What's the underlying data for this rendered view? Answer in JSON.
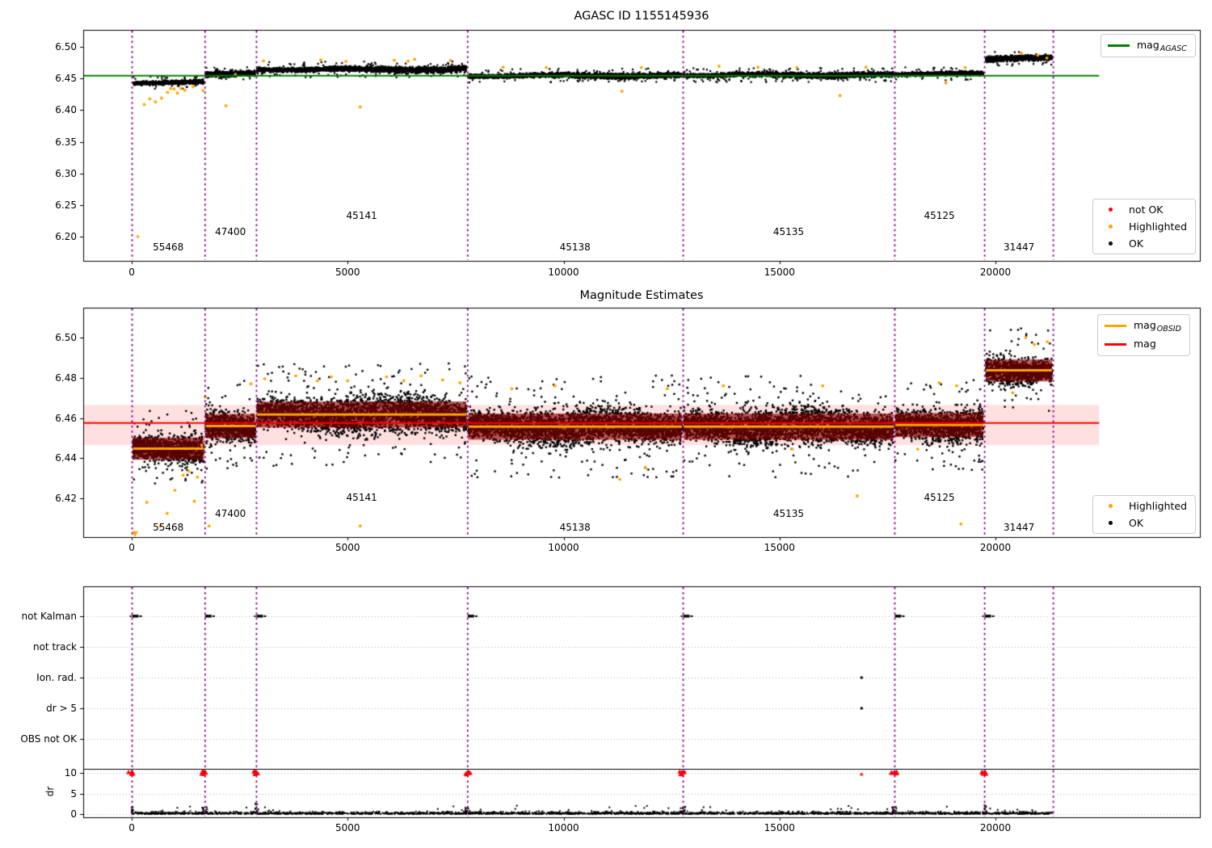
{
  "colors": {
    "mag_agasc_line": "#008000",
    "mag_line": "#ff0000",
    "mag_obsid_line": "#ffa500",
    "highlighted": "#ffa500",
    "not_ok": "#ff0000",
    "ok": "#000000",
    "obsid_boundary": "#8b008b",
    "mag_band_fill": "rgba(255,0,0,0.12)",
    "obsid_err_band_fill": "rgba(139,0,0,0.62)",
    "grid_line": "rgba(0,0,0,0.30)"
  },
  "shared": {
    "xticks": [
      0,
      5000,
      10000,
      15000,
      20000
    ],
    "xtick_labels": [
      "0",
      "5000",
      "10000",
      "15000",
      "20000"
    ],
    "xlim": [
      -1123,
      24733
    ],
    "obsid_boundaries": [
      0,
      1690,
      2880,
      7770,
      12760,
      17660,
      19740,
      21330
    ],
    "mag_line_x_end": 22400,
    "segments": [
      {
        "obsid": "55468",
        "x": [
          30,
          1670
        ],
        "label_x": 845,
        "tier": 0,
        "top": {
          "center": 6.4435,
          "half": 0.0055,
          "n": 900
        },
        "mid": {
          "center": 6.4447,
          "half": 0.01,
          "n": 1100,
          "band_half": 0.0055
        }
      },
      {
        "obsid": "47400",
        "x": [
          1710,
          2860
        ],
        "label_x": 2285,
        "tier": 1,
        "top": {
          "center": 6.458,
          "half": 0.0055,
          "n": 650
        },
        "mid": {
          "center": 6.456,
          "half": 0.012,
          "n": 800,
          "band_half": 0.006
        }
      },
      {
        "obsid": "45141",
        "x": [
          2900,
          7750
        ],
        "label_x": 5325,
        "tier": 2,
        "top": {
          "center": 6.4645,
          "half": 0.0068,
          "n": 2400
        },
        "mid": {
          "center": 6.4617,
          "half": 0.0135,
          "n": 3000,
          "band_half": 0.0065
        }
      },
      {
        "obsid": "45138",
        "x": [
          7790,
          12740
        ],
        "label_x": 10265,
        "tier": 0,
        "top": {
          "center": 6.4545,
          "half": 0.006,
          "n": 2400
        },
        "mid": {
          "center": 6.4557,
          "half": 0.0135,
          "n": 3000,
          "band_half": 0.0065
        }
      },
      {
        "obsid": "45135",
        "x": [
          12780,
          17640
        ],
        "label_x": 15210,
        "tier": 1,
        "top": {
          "center": 6.4555,
          "half": 0.006,
          "n": 2400
        },
        "mid": {
          "center": 6.4557,
          "half": 0.0135,
          "n": 3000,
          "band_half": 0.0065
        }
      },
      {
        "obsid": "45125",
        "x": [
          17680,
          19720
        ],
        "label_x": 18700,
        "tier": 2,
        "top": {
          "center": 6.4575,
          "half": 0.0055,
          "n": 1050
        },
        "mid": {
          "center": 6.4565,
          "half": 0.012,
          "n": 1300,
          "band_half": 0.006
        }
      },
      {
        "obsid": "31447",
        "x": [
          19780,
          21310
        ],
        "label_x": 20545,
        "tier": 0,
        "top": {
          "center": 6.4815,
          "half": 0.006,
          "n": 800
        },
        "mid": {
          "center": 6.4837,
          "half": 0.011,
          "n": 1000,
          "band_half": 0.0055
        }
      }
    ]
  },
  "chart_data": [
    {
      "id": "mag-vs-agasc",
      "type": "scatter",
      "title": "AGASC ID 1155145936",
      "ylim": [
        6.1615,
        6.527
      ],
      "yticks": [
        6.2,
        6.25,
        6.3,
        6.35,
        6.4,
        6.45,
        6.5
      ],
      "ytick_labels": [
        "6.20",
        "6.25",
        "6.30",
        "6.35",
        "6.40",
        "6.45",
        "6.50"
      ],
      "mag_agasc": 6.4545,
      "legend_line": {
        "base": "mag",
        "sub": "AGASC"
      },
      "legend_markers": [
        {
          "label": "not OK",
          "color": "not_ok"
        },
        {
          "label": "Highlighted",
          "color": "highlighted"
        },
        {
          "label": "OK",
          "color": "ok"
        }
      ],
      "label_tier_mags": [
        6.1835,
        6.2075,
        6.2325
      ],
      "highlighted_points": [
        [
          140,
          6.2
        ],
        [
          290,
          6.409
        ],
        [
          420,
          6.418
        ],
        [
          550,
          6.413
        ],
        [
          690,
          6.419
        ],
        [
          830,
          6.428
        ],
        [
          900,
          6.434
        ],
        [
          980,
          6.4335
        ],
        [
          1060,
          6.427
        ],
        [
          1140,
          6.4345
        ],
        [
          1230,
          6.4315
        ],
        [
          1420,
          6.437
        ],
        [
          1650,
          6.431
        ],
        [
          2180,
          6.407
        ],
        [
          2400,
          6.4565
        ],
        [
          3050,
          6.478
        ],
        [
          4380,
          6.4795
        ],
        [
          4960,
          6.477
        ],
        [
          5290,
          6.405
        ],
        [
          6080,
          6.479
        ],
        [
          6400,
          6.4775
        ],
        [
          6550,
          6.4805
        ],
        [
          7380,
          6.4785
        ],
        [
          8600,
          6.468
        ],
        [
          9600,
          6.4675
        ],
        [
          11350,
          6.43
        ],
        [
          11800,
          6.4675
        ],
        [
          13600,
          6.4695
        ],
        [
          14500,
          6.468
        ],
        [
          15400,
          6.4675
        ],
        [
          16400,
          6.423
        ],
        [
          17000,
          6.468
        ],
        [
          18850,
          6.443
        ],
        [
          19300,
          6.4675
        ],
        [
          20600,
          6.4895
        ],
        [
          20980,
          6.487
        ],
        [
          21190,
          6.4825
        ]
      ]
    },
    {
      "id": "mag-estimates",
      "type": "scatter",
      "title": "Magnitude Estimates",
      "ylim": [
        6.4007,
        6.5149
      ],
      "yticks": [
        6.42,
        6.44,
        6.46,
        6.48,
        6.5
      ],
      "ytick_labels": [
        "6.42",
        "6.44",
        "6.46",
        "6.48",
        "6.50"
      ],
      "mag": 6.4575,
      "mag_band": [
        6.4465,
        6.4665
      ],
      "legend_lines": [
        {
          "base": "mag",
          "sub": "OBSID",
          "color": "mag_obsid_line"
        },
        {
          "base": "mag",
          "sub": "",
          "color": "mag_line"
        }
      ],
      "legend_markers": [
        {
          "label": "Highlighted",
          "color": "highlighted"
        },
        {
          "label": "OK",
          "color": "ok"
        }
      ],
      "label_tier_mags": [
        6.4055,
        6.4125,
        6.4205
      ],
      "low_clip_marker_x": 75,
      "highlighted_points": [
        [
          350,
          6.418
        ],
        [
          660,
          6.4062
        ],
        [
          820,
          6.4125
        ],
        [
          1000,
          6.424
        ],
        [
          1190,
          6.4315
        ],
        [
          1320,
          6.4335
        ],
        [
          1450,
          6.4185
        ],
        [
          1520,
          6.4305
        ],
        [
          1620,
          6.4465
        ],
        [
          1700,
          6.4705
        ],
        [
          1790,
          6.4062
        ],
        [
          2760,
          6.477
        ],
        [
          3080,
          6.4795
        ],
        [
          3800,
          6.481
        ],
        [
          4300,
          6.4785
        ],
        [
          4620,
          6.4805
        ],
        [
          5000,
          6.4785
        ],
        [
          5290,
          6.4062
        ],
        [
          5900,
          6.4805
        ],
        [
          6300,
          6.4785
        ],
        [
          6700,
          6.481
        ],
        [
          7200,
          6.479
        ],
        [
          7600,
          6.4775
        ],
        [
          8800,
          6.4745
        ],
        [
          9800,
          6.476
        ],
        [
          11300,
          6.4295
        ],
        [
          11900,
          6.435
        ],
        [
          12400,
          6.4745
        ],
        [
          13700,
          6.476
        ],
        [
          15300,
          6.4445
        ],
        [
          16000,
          6.476
        ],
        [
          16800,
          6.4212
        ],
        [
          18200,
          6.4445
        ],
        [
          18700,
          6.4775
        ],
        [
          19100,
          6.476
        ],
        [
          19200,
          6.4072
        ],
        [
          20400,
          6.4725
        ],
        [
          20700,
          6.5
        ],
        [
          20900,
          6.4965
        ],
        [
          21200,
          6.498
        ]
      ]
    },
    {
      "id": "flags",
      "type": "scatter",
      "categories": [
        "not Kalman",
        "not track",
        "Ion. rad.",
        "dr > 5",
        "OBS not OK"
      ],
      "dr_ticks": [
        10,
        5,
        0
      ],
      "dr_tick_labels": [
        "10",
        "5",
        "0"
      ],
      "ylabel": "dr",
      "flag_points": {
        "not Kalman": [
          0,
          1690,
          2880,
          7770,
          12760,
          17660,
          19740
        ],
        "not track": [],
        "Ion. rad.": [
          16900
        ],
        "dr > 5": [
          16900
        ],
        "OBS not OK": []
      },
      "dr_clipped_x": [
        0,
        1690,
        2880,
        7770,
        12760,
        17660,
        19740
      ],
      "dr_clipped_small_x": [
        16900
      ],
      "dr_noise_x_range": [
        0,
        21330
      ],
      "clip_line_dr": 11
    }
  ]
}
